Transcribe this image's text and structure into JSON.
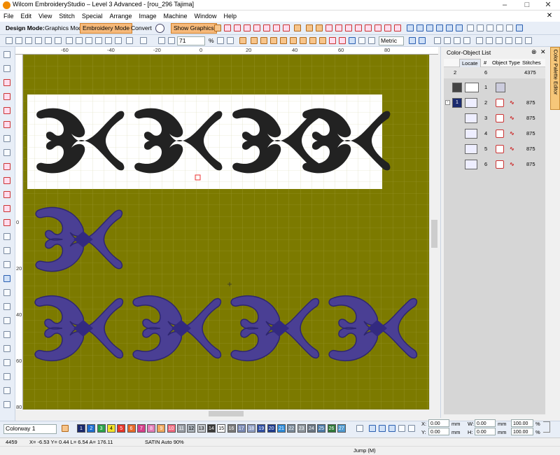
{
  "title": "Wilcom EmbroideryStudio – Level 3 Advanced - [rou_296    Tajima]",
  "menu": [
    "File",
    "Edit",
    "View",
    "Stitch",
    "Special",
    "Arrange",
    "Image",
    "Machine",
    "Window",
    "Help"
  ],
  "toolbar": {
    "design_mode_label": "Design Mode:",
    "graphics_mode": "Graphics Mode",
    "embroidery_mode": "Embroidery Mode",
    "convert": "Convert",
    "show_graphics": "Show Graphics",
    "zoom_value": "71",
    "zoom_unit": "%",
    "units": "Metric"
  },
  "ruler_top": [
    "-60",
    "-40",
    "-20",
    "0",
    "20",
    "40",
    "60",
    "80"
  ],
  "ruler_left": [
    "0",
    "20",
    "40",
    "60",
    "80"
  ],
  "panel": {
    "title": "Color-Object List",
    "side_tab": "Color Palette Editor",
    "columns": [
      "Locate",
      "#",
      "Object Type",
      "Stitches"
    ],
    "summary": {
      "color_no": "2",
      "objects": "6",
      "stitches": "4375"
    },
    "rows": [
      {
        "num": "1",
        "stitches": ""
      },
      {
        "num": "2",
        "stitches": "875"
      },
      {
        "num": "3",
        "stitches": "875"
      },
      {
        "num": "4",
        "stitches": "875"
      },
      {
        "num": "5",
        "stitches": "875"
      },
      {
        "num": "6",
        "stitches": "875"
      }
    ]
  },
  "colorway": {
    "label": "Colorway 1"
  },
  "palette": [
    {
      "n": "1",
      "c": "#1a2a6e"
    },
    {
      "n": "2",
      "c": "#1f6fd0"
    },
    {
      "n": "3",
      "c": "#2aa34a"
    },
    {
      "n": "4",
      "c": "#f2e22b"
    },
    {
      "n": "5",
      "c": "#e8352a"
    },
    {
      "n": "6",
      "c": "#e86a2a"
    },
    {
      "n": "7",
      "c": "#d63f8c"
    },
    {
      "n": "8",
      "c": "#e37cb8"
    },
    {
      "n": "9",
      "c": "#f0a85e"
    },
    {
      "n": "10",
      "c": "#f06a80"
    },
    {
      "n": "11",
      "c": "#9aa0a8"
    },
    {
      "n": "12",
      "c": "#a8b0b8"
    },
    {
      "n": "13",
      "c": "#c5c9ce"
    },
    {
      "n": "14",
      "c": "#3a3a3a"
    },
    {
      "n": "15",
      "c": "#ffffff"
    },
    {
      "n": "16",
      "c": "#7a7a7a"
    },
    {
      "n": "17",
      "c": "#7a8ab5"
    },
    {
      "n": "18",
      "c": "#8f9fc5"
    },
    {
      "n": "19",
      "c": "#2e4fa5"
    },
    {
      "n": "20",
      "c": "#1d3b8f"
    },
    {
      "n": "21",
      "c": "#2c8ad8"
    },
    {
      "n": "22",
      "c": "#7a8a9a"
    },
    {
      "n": "23",
      "c": "#8f98a0"
    },
    {
      "n": "24",
      "c": "#6a7684"
    },
    {
      "n": "25",
      "c": "#4c7aa8"
    },
    {
      "n": "26",
      "c": "#2f7a3a"
    },
    {
      "n": "27",
      "c": "#4f9ad0"
    }
  ],
  "coords": {
    "x_label": "X:",
    "x": "0.00",
    "y_label": "Y:",
    "y": "0.00",
    "w_label": "W:",
    "w": "0.00",
    "h_label": "H:",
    "h": "0.00",
    "unit_mm": "mm",
    "pw": "100.00",
    "ph": "100.00",
    "unit_pct": "%"
  },
  "status": {
    "stitch_count": "4459",
    "position": "X=  -6.53 Y=   0.44 L=    6.54 A= 176.11",
    "stitch_type": "SATIN Auto 90%",
    "jump": "Jump (M)"
  },
  "colors": {
    "canvas": "#7c7a00",
    "embroidery": "#4a3f94",
    "accent": "#f6b97a"
  }
}
